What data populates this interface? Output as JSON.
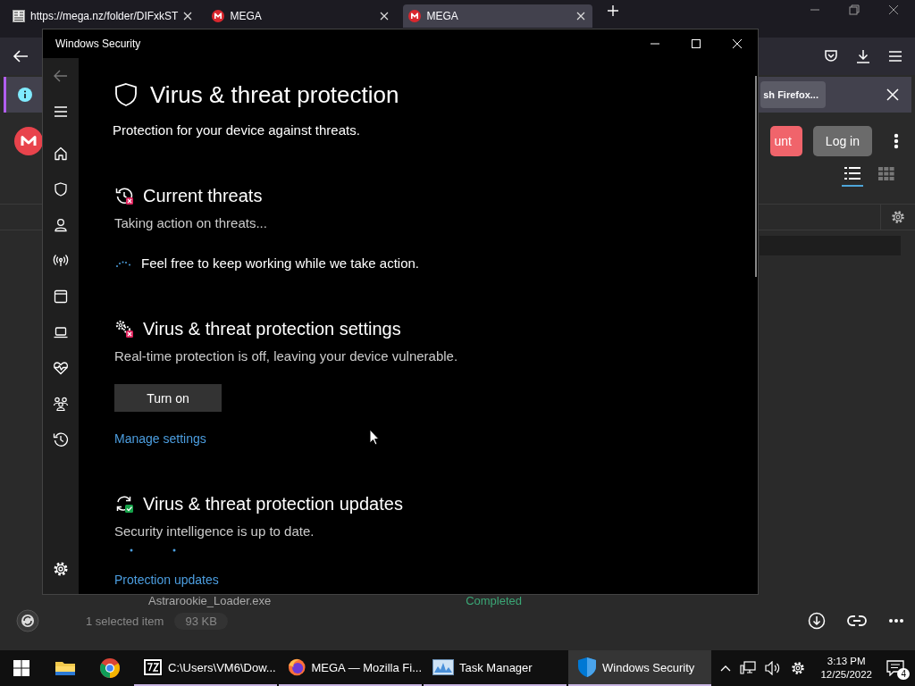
{
  "browser": {
    "tabs": [
      {
        "title": "https://mega.nz/folder/DIFxkST",
        "kind": "page",
        "selected": false
      },
      {
        "title": "MEGA",
        "kind": "mega",
        "selected": false
      },
      {
        "title": "MEGA",
        "kind": "mega",
        "selected": true
      }
    ],
    "notification": {
      "button": "sh Firefox..."
    },
    "header_buttons": [
      {
        "label": "unt",
        "kind": "primary"
      },
      {
        "label": "Log in",
        "kind": "secondary"
      }
    ],
    "view_modes": [
      {
        "kind": "list",
        "selected": true
      },
      {
        "kind": "grid",
        "selected": false
      }
    ],
    "transfer": {
      "file": "Astrarookie_Loader.exe",
      "status": "Completed"
    },
    "footer": {
      "selection": "1 selected item",
      "size": "93 KB"
    }
  },
  "security_window": {
    "title": "Windows Security",
    "nav": [
      {
        "kind": "back"
      },
      {
        "kind": "menu"
      },
      {
        "kind": "home"
      },
      {
        "kind": "shield"
      },
      {
        "kind": "account"
      },
      {
        "kind": "network"
      },
      {
        "kind": "app"
      },
      {
        "kind": "device"
      },
      {
        "kind": "health"
      },
      {
        "kind": "family"
      },
      {
        "kind": "history"
      },
      {
        "kind": "settings"
      }
    ],
    "page": {
      "title": "Virus & threat protection",
      "subtitle": "Protection for your device against threats.",
      "sections": [
        {
          "kind": "threats",
          "title": "Current threats",
          "status": "Taking action on threats...",
          "note": "Feel free to keep working while we take action."
        },
        {
          "kind": "settings",
          "title": "Virus & threat protection settings",
          "status": "Real-time protection is off, leaving your device vulnerable.",
          "button": "Turn on",
          "link": "Manage settings"
        },
        {
          "kind": "updates",
          "title": "Virus & threat protection updates",
          "status": "Security intelligence is up to date.",
          "link": "Protection updates"
        }
      ]
    }
  },
  "taskbar": {
    "apps": [
      {
        "kind": "explorer"
      },
      {
        "kind": "chrome"
      },
      {
        "kind": "archiver",
        "label": "C:\\Users\\VM6\\Dow...",
        "selected": false
      },
      {
        "kind": "firefox",
        "label": "MEGA — Mozilla Fi...",
        "selected": false
      },
      {
        "kind": "taskmanager",
        "label": "Task Manager",
        "selected": false
      },
      {
        "kind": "security",
        "label": "Windows Security",
        "selected": true
      }
    ],
    "clock": {
      "time": "3:13 PM",
      "date": "12/25/2022"
    },
    "notifications": "4"
  }
}
